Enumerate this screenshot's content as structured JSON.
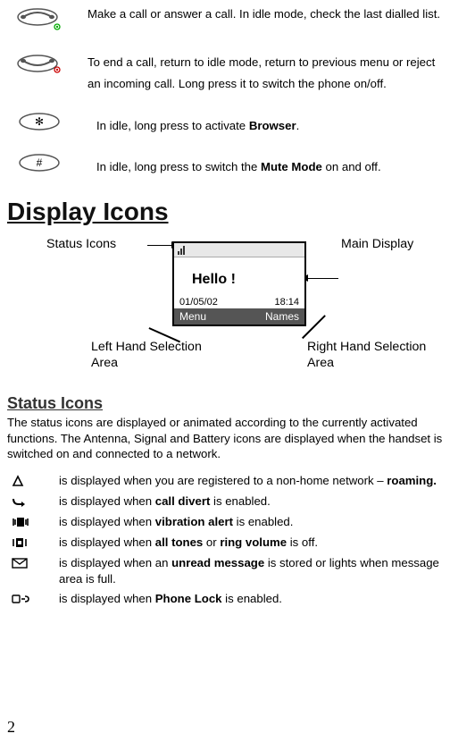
{
  "keys": [
    {
      "parts": [
        [
          false,
          "Make a call or answer a call. In idle mode, check the last dialled list."
        ]
      ]
    },
    {
      "parts": [
        [
          false,
          "To end a call, return to idle mode, return to previous menu or reject an incoming call. Long press it to switch the phone on/off."
        ]
      ]
    },
    {
      "parts": [
        [
          false,
          "In idle, long press to activate "
        ],
        [
          true,
          "Browser"
        ],
        [
          false,
          "."
        ]
      ]
    },
    {
      "parts": [
        [
          false,
          "In idle, long press to switch the "
        ],
        [
          true,
          "Mute Mode"
        ],
        [
          false,
          " on and off."
        ]
      ]
    }
  ],
  "heading_display": "Display Icons",
  "labels": {
    "status_icons": "Status Icons",
    "main_display": "Main Display",
    "left_select": "Left Hand Selection  Area",
    "right_select": "Right Hand Selection Area"
  },
  "screen": {
    "hello": "Hello !",
    "date": "01/05/02",
    "time": "18:14",
    "menu": "Menu",
    "names": "Names"
  },
  "heading_status": "Status Icons",
  "status_intro": "The status icons are displayed or animated according to the currently activated functions. The Antenna, Signal and Battery icons are displayed when the handset is switched on and connected to a network.",
  "status_items": [
    {
      "parts": [
        [
          false,
          "is displayed when you are registered to a non-home network – "
        ],
        [
          true,
          "roaming."
        ]
      ]
    },
    {
      "parts": [
        [
          false,
          "is displayed when "
        ],
        [
          true,
          "call divert"
        ],
        [
          false,
          " is enabled."
        ]
      ]
    },
    {
      "parts": [
        [
          false,
          "is displayed when "
        ],
        [
          true,
          "vibration alert"
        ],
        [
          false,
          " is enabled."
        ]
      ]
    },
    {
      "parts": [
        [
          false,
          "is displayed when "
        ],
        [
          true,
          "all tones"
        ],
        [
          false,
          " or "
        ],
        [
          true,
          "ring volume"
        ],
        [
          false,
          " is off."
        ]
      ]
    },
    {
      "parts": [
        [
          false,
          "is displayed when an "
        ],
        [
          true,
          "unread message"
        ],
        [
          false,
          " is stored or lights when message area is full."
        ]
      ]
    },
    {
      "parts": [
        [
          false,
          "is displayed when "
        ],
        [
          true,
          "Phone Lock"
        ],
        [
          false,
          " is enabled."
        ]
      ]
    }
  ],
  "page": "2"
}
